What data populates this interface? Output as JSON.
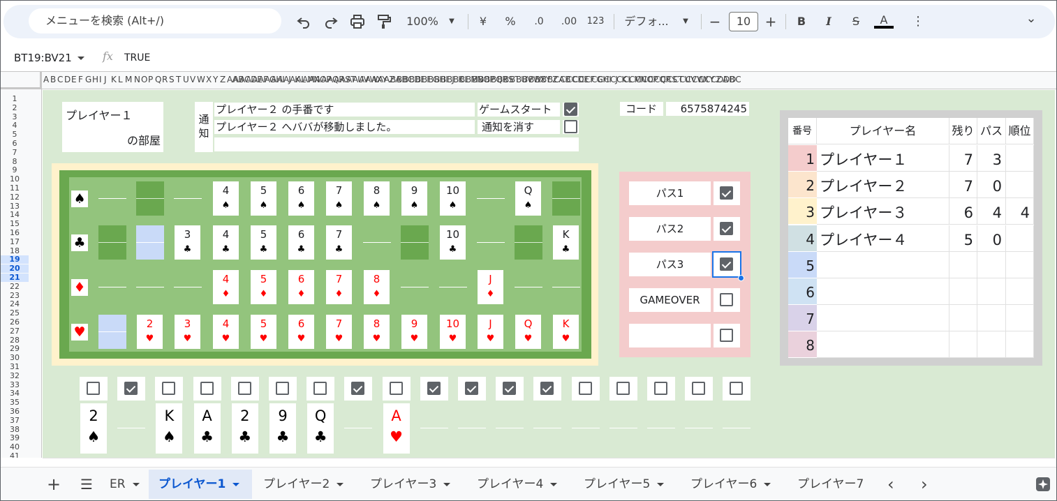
{
  "toolbar": {
    "search_placeholder": "メニューを検索 (Alt+/)",
    "zoom": "100%",
    "currency": "¥",
    "percent": "%",
    "dec_decrease": ".0",
    "dec_increase": ".00",
    "number_format": "123",
    "font": "デフォ...",
    "font_size": "10",
    "bold": "B",
    "italic": "I",
    "strike": "S",
    "text_color": "A",
    "more": "⋮",
    "collapse": "⌄"
  },
  "formula_bar": {
    "name_box": "BT19:BV21",
    "fx": "fx",
    "value": "TRUE"
  },
  "column_headers": "A B C D E F G H I J K L M N O P Q R S T U V W X Y Z AA AB AC AD AE AF AG AH AI AJ AK AL AM AN AO AP AQ AR AS AT AU AV AW AX AY AZ BA BB BC BD BE BF BG BH BI BJ BK BL BM BN BO BP BQ BR BS BT BU BV BW BX BY BZ CA CB CC CD CE CF CG CH CI CJ CK CL CM CN CO CP CQ CR CS CT CU CV CW CX CY CZ DA DB DC",
  "row_headers": [
    "1",
    "2",
    "3",
    "4",
    "5",
    "6",
    "7",
    "8",
    "9",
    "10",
    "11",
    "12",
    "13",
    "14",
    "15",
    "16",
    "17",
    "18",
    "19",
    "20",
    "21",
    "22",
    "23",
    "24",
    "25",
    "26",
    "27",
    "28",
    "29",
    "30",
    "31",
    "32",
    "33",
    "34",
    "35",
    "36",
    "37",
    "38",
    "39",
    "40",
    "41"
  ],
  "room": {
    "player": "プレイヤー１",
    "suffix": "の部屋"
  },
  "notice": {
    "label": "通\n知",
    "line1": "プレイヤー２ の手番です",
    "line2": "プレイヤー２ へババが移動しました。",
    "game_start": "ゲームスタート",
    "game_start_checked": true,
    "dismiss": "通知を消す",
    "dismiss_checked": false
  },
  "code": {
    "label": "コード",
    "value": "6575874245"
  },
  "board": {
    "rows": [
      {
        "suit": "♠",
        "color": "#000000",
        "cells": [
          {
            "t": "dash"
          },
          {
            "t": "green"
          },
          {
            "t": "dash"
          },
          {
            "t": "card",
            "r": "4"
          },
          {
            "t": "card",
            "r": "5"
          },
          {
            "t": "card",
            "r": "6"
          },
          {
            "t": "card",
            "r": "7"
          },
          {
            "t": "card",
            "r": "8"
          },
          {
            "t": "card",
            "r": "9"
          },
          {
            "t": "card",
            "r": "10"
          },
          {
            "t": "dash"
          },
          {
            "t": "card",
            "r": "Q"
          },
          {
            "t": "green"
          }
        ]
      },
      {
        "suit": "♣",
        "color": "#000000",
        "cells": [
          {
            "t": "green"
          },
          {
            "t": "blue"
          },
          {
            "t": "card",
            "r": "3"
          },
          {
            "t": "card",
            "r": "4"
          },
          {
            "t": "card",
            "r": "5"
          },
          {
            "t": "card",
            "r": "6"
          },
          {
            "t": "card",
            "r": "7"
          },
          {
            "t": "dash"
          },
          {
            "t": "green"
          },
          {
            "t": "card",
            "r": "10"
          },
          {
            "t": "dash"
          },
          {
            "t": "green"
          },
          {
            "t": "card",
            "r": "K"
          }
        ]
      },
      {
        "suit": "♦",
        "color": "#ff0000",
        "cells": [
          {
            "t": "dash"
          },
          {
            "t": "dash"
          },
          {
            "t": "dash"
          },
          {
            "t": "card",
            "r": "4"
          },
          {
            "t": "card",
            "r": "5"
          },
          {
            "t": "card",
            "r": "6"
          },
          {
            "t": "card",
            "r": "7"
          },
          {
            "t": "card",
            "r": "8"
          },
          {
            "t": "dash"
          },
          {
            "t": "dash"
          },
          {
            "t": "card",
            "r": "J"
          },
          {
            "t": "dash"
          },
          {
            "t": "dash"
          }
        ]
      },
      {
        "suit": "♥",
        "color": "#ff0000",
        "cells": [
          {
            "t": "blue"
          },
          {
            "t": "card",
            "r": "2"
          },
          {
            "t": "card",
            "r": "3"
          },
          {
            "t": "card",
            "r": "4"
          },
          {
            "t": "card",
            "r": "5"
          },
          {
            "t": "card",
            "r": "6"
          },
          {
            "t": "card",
            "r": "7"
          },
          {
            "t": "card",
            "r": "8"
          },
          {
            "t": "card",
            "r": "9"
          },
          {
            "t": "card",
            "r": "10"
          },
          {
            "t": "card",
            "r": "J"
          },
          {
            "t": "card",
            "r": "Q"
          },
          {
            "t": "card",
            "r": "K"
          }
        ]
      }
    ]
  },
  "pass": [
    {
      "label": "パス1",
      "checked": true
    },
    {
      "label": "パス2",
      "checked": true
    },
    {
      "label": "パス3",
      "checked": true
    },
    {
      "label": "GAMEOVER",
      "checked": false
    },
    {
      "label": "",
      "checked": false
    }
  ],
  "ranking": {
    "headers": [
      "番号",
      "プレイヤー名",
      "残り",
      "パス",
      "順位"
    ],
    "rows": [
      {
        "no": "1",
        "name": "プレイヤー１",
        "left": "7",
        "pass": "3",
        "rank": "",
        "color": "#f4cccc"
      },
      {
        "no": "2",
        "name": "プレイヤー２",
        "left": "7",
        "pass": "0",
        "rank": "",
        "color": "#fce5cd"
      },
      {
        "no": "3",
        "name": "プレイヤー３",
        "left": "6",
        "pass": "4",
        "rank": "4",
        "color": "#fff2cc"
      },
      {
        "no": "4",
        "name": "プレイヤー４",
        "left": "5",
        "pass": "0",
        "rank": "",
        "color": "#d0e0e3"
      },
      {
        "no": "5",
        "name": "",
        "left": "",
        "pass": "",
        "rank": "",
        "color": "#c9daf8"
      },
      {
        "no": "6",
        "name": "",
        "left": "",
        "pass": "",
        "rank": "",
        "color": "#cfe2f3"
      },
      {
        "no": "7",
        "name": "",
        "left": "",
        "pass": "",
        "rank": "",
        "color": "#d9d2e9"
      },
      {
        "no": "8",
        "name": "",
        "left": "",
        "pass": "",
        "rank": "",
        "color": "#ead1dc"
      }
    ]
  },
  "hand": [
    {
      "checked": false,
      "rank": "2",
      "suit": "♠",
      "color": "#000000"
    },
    {
      "checked": true,
      "rank": "",
      "suit": "",
      "color": ""
    },
    {
      "checked": false,
      "rank": "K",
      "suit": "♠",
      "color": "#000000"
    },
    {
      "checked": false,
      "rank": "A",
      "suit": "♣",
      "color": "#000000"
    },
    {
      "checked": false,
      "rank": "2",
      "suit": "♣",
      "color": "#000000"
    },
    {
      "checked": false,
      "rank": "9",
      "suit": "♣",
      "color": "#000000"
    },
    {
      "checked": false,
      "rank": "Q",
      "suit": "♣",
      "color": "#000000"
    },
    {
      "checked": true,
      "rank": "",
      "suit": "",
      "color": ""
    },
    {
      "checked": false,
      "rank": "A",
      "suit": "♥",
      "color": "#ff0000"
    },
    {
      "checked": true,
      "rank": "",
      "suit": "",
      "color": ""
    },
    {
      "checked": true,
      "rank": "",
      "suit": "",
      "color": ""
    },
    {
      "checked": true,
      "rank": "",
      "suit": "",
      "color": ""
    },
    {
      "checked": true,
      "rank": "",
      "suit": "",
      "color": ""
    },
    {
      "checked": false,
      "rank": "",
      "suit": "",
      "color": ""
    },
    {
      "checked": false,
      "rank": "",
      "suit": "",
      "color": ""
    },
    {
      "checked": false,
      "rank": "",
      "suit": "",
      "color": ""
    },
    {
      "checked": false,
      "rank": "",
      "suit": "",
      "color": ""
    },
    {
      "checked": false,
      "rank": "",
      "suit": "",
      "color": ""
    }
  ],
  "tabs": {
    "add": "+",
    "all": "☰",
    "truncated": "ER",
    "items": [
      "プレイヤー1",
      "プレイヤー2",
      "プレイヤー3",
      "プレイヤー4",
      "プレイヤー5",
      "プレイヤー6",
      "プレイヤー7"
    ],
    "active": 0,
    "prev": "‹",
    "next": "›"
  }
}
